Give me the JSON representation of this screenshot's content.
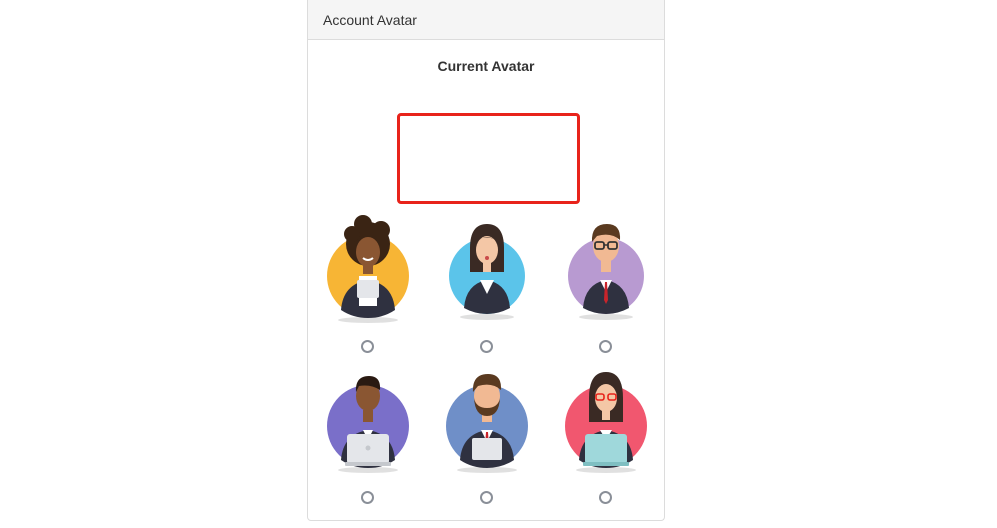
{
  "panel": {
    "header_title": "Account Avatar",
    "current_title": "Current Avatar"
  },
  "avatars": [
    {
      "name": "woman-curly-hair-tablet",
      "bg": "#f7b535",
      "selected": false
    },
    {
      "name": "woman-dark-hair-suit",
      "bg": "#5bc4ea",
      "selected": false
    },
    {
      "name": "man-glasses-red-tie",
      "bg": "#b89ad1",
      "selected": false
    },
    {
      "name": "man-laptop-purple",
      "bg": "#7a6fc9",
      "selected": false
    },
    {
      "name": "man-beard-tablet",
      "bg": "#6f8fc8",
      "selected": false
    },
    {
      "name": "woman-glasses-laptop",
      "bg": "#f1576f",
      "selected": false
    }
  ],
  "colors": {
    "preview_border": "#e8231b",
    "header_bg": "#f5f5f5"
  }
}
